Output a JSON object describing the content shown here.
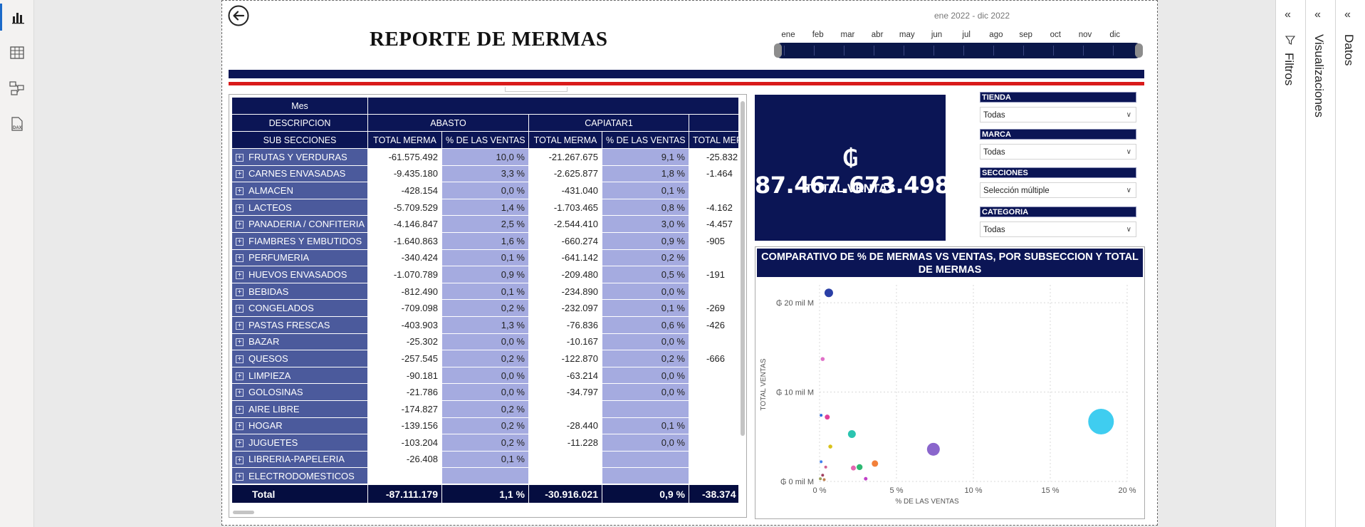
{
  "nav": {
    "icons": [
      "report-view-icon",
      "table-view-icon",
      "model-view-icon",
      "dax-query-icon"
    ]
  },
  "report": {
    "title": "REPORTE DE MERMAS",
    "date_range": "ene 2022 - dic 2022",
    "months": [
      "ene",
      "feb",
      "mar",
      "abr",
      "may",
      "jun",
      "jul",
      "ago",
      "sep",
      "oct",
      "nov",
      "dic"
    ]
  },
  "matrix": {
    "header_mes": "Mes",
    "header_descripcion": "DESCRIPCION",
    "header_subsecciones": "SUB SECCIONES",
    "groups": [
      "ABASTO",
      "CAPIATAR1"
    ],
    "col_total_merma": "TOTAL MERMA",
    "col_pct_ventas": "% DE LAS VENTAS",
    "col_total_merma_cut": "TOTAL MER",
    "rows": [
      {
        "label": "FRUTAS Y VERDURAS",
        "a_tm": "-61.575.492",
        "a_pct": "10,0 %",
        "c_tm": "-21.267.675",
        "c_pct": "9,1 %",
        "n_tm": "-25.832"
      },
      {
        "label": "CARNES ENVASADAS",
        "a_tm": "-9.435.180",
        "a_pct": "3,3 %",
        "c_tm": "-2.625.877",
        "c_pct": "1,8 %",
        "n_tm": "-1.464"
      },
      {
        "label": "ALMACEN",
        "a_tm": "-428.154",
        "a_pct": "0,0 %",
        "c_tm": "-431.040",
        "c_pct": "0,1 %",
        "n_tm": ""
      },
      {
        "label": "LACTEOS",
        "a_tm": "-5.709.529",
        "a_pct": "1,4 %",
        "c_tm": "-1.703.465",
        "c_pct": "0,8 %",
        "n_tm": "-4.162"
      },
      {
        "label": "PANADERIA / CONFITERIA",
        "a_tm": "-4.146.847",
        "a_pct": "2,5 %",
        "c_tm": "-2.544.410",
        "c_pct": "3,0 %",
        "n_tm": "-4.457"
      },
      {
        "label": "FIAMBRES Y EMBUTIDOS",
        "a_tm": "-1.640.863",
        "a_pct": "1,6 %",
        "c_tm": "-660.274",
        "c_pct": "0,9 %",
        "n_tm": "-905"
      },
      {
        "label": "PERFUMERIA",
        "a_tm": "-340.424",
        "a_pct": "0,1 %",
        "c_tm": "-641.142",
        "c_pct": "0,2 %",
        "n_tm": ""
      },
      {
        "label": "HUEVOS ENVASADOS",
        "a_tm": "-1.070.789",
        "a_pct": "0,9 %",
        "c_tm": "-209.480",
        "c_pct": "0,5 %",
        "n_tm": "-191"
      },
      {
        "label": "BEBIDAS",
        "a_tm": "-812.490",
        "a_pct": "0,1 %",
        "c_tm": "-234.890",
        "c_pct": "0,0 %",
        "n_tm": ""
      },
      {
        "label": "CONGELADOS",
        "a_tm": "-709.098",
        "a_pct": "0,2 %",
        "c_tm": "-232.097",
        "c_pct": "0,1 %",
        "n_tm": "-269"
      },
      {
        "label": "PASTAS FRESCAS",
        "a_tm": "-403.903",
        "a_pct": "1,3 %",
        "c_tm": "-76.836",
        "c_pct": "0,6 %",
        "n_tm": "-426"
      },
      {
        "label": "BAZAR",
        "a_tm": "-25.302",
        "a_pct": "0,0 %",
        "c_tm": "-10.167",
        "c_pct": "0,0 %",
        "n_tm": ""
      },
      {
        "label": "QUESOS",
        "a_tm": "-257.545",
        "a_pct": "0,2 %",
        "c_tm": "-122.870",
        "c_pct": "0,2 %",
        "n_tm": "-666"
      },
      {
        "label": "LIMPIEZA",
        "a_tm": "-90.181",
        "a_pct": "0,0 %",
        "c_tm": "-63.214",
        "c_pct": "0,0 %",
        "n_tm": ""
      },
      {
        "label": "GOLOSINAS",
        "a_tm": "-21.786",
        "a_pct": "0,0 %",
        "c_tm": "-34.797",
        "c_pct": "0,0 %",
        "n_tm": ""
      },
      {
        "label": "AIRE LIBRE",
        "a_tm": "-174.827",
        "a_pct": "0,2 %",
        "c_tm": "",
        "c_pct": "",
        "n_tm": ""
      },
      {
        "label": "HOGAR",
        "a_tm": "-139.156",
        "a_pct": "0,2 %",
        "c_tm": "-28.440",
        "c_pct": "0,1 %",
        "n_tm": ""
      },
      {
        "label": "JUGUETES",
        "a_tm": "-103.204",
        "a_pct": "0,2 %",
        "c_tm": "-11.228",
        "c_pct": "0,0 %",
        "n_tm": ""
      },
      {
        "label": "LIBRERIA-PAPELERIA",
        "a_tm": "-26.408",
        "a_pct": "0,1 %",
        "c_tm": "",
        "c_pct": "",
        "n_tm": ""
      },
      {
        "label": "ELECTRODOMESTICOS",
        "a_tm": "",
        "a_pct": "",
        "c_tm": "",
        "c_pct": "",
        "n_tm": ""
      }
    ],
    "total": {
      "label": "Total",
      "a_tm": "-87.111.179",
      "a_pct": "1,1 %",
      "c_tm": "-30.916.021",
      "c_pct": "0,9 %",
      "n_tm": "-38.374"
    }
  },
  "kpi": {
    "value": "₲ 87.467.673.498",
    "label": "TOTAL VENTAS"
  },
  "slicers": [
    {
      "title": "TIENDA",
      "value": "Todas"
    },
    {
      "title": "MARCA",
      "value": "Todas"
    },
    {
      "title": "SECCIONES",
      "value": "Selección múltiple"
    },
    {
      "title": "CATEGORIA",
      "value": "Todas"
    }
  ],
  "panes": {
    "filtros": "Filtros",
    "visualizaciones": "Visualizaciones",
    "datos": "Datos"
  },
  "chart_data": {
    "type": "scatter",
    "title": "COMPARATIVO DE % DE MERMAS VS VENTAS, POR SUBSECCION Y TOTAL DE MERMAS",
    "xlabel": "% DE LAS VENTAS",
    "ylabel": "TOTAL VENTAS",
    "xlim": [
      0,
      20
    ],
    "ylim": [
      0,
      22
    ],
    "x_ticks": [
      "0 %",
      "5 %",
      "10 %",
      "15 %",
      "20 %"
    ],
    "y_ticks": [
      "₲ 0 mil M",
      "₲ 10 mil M",
      "₲ 20 mil M"
    ],
    "grid": true,
    "points": [
      {
        "x": 18.3,
        "y": 6.7,
        "size": 18,
        "color": "#3fcdf0"
      },
      {
        "x": 7.4,
        "y": 3.6,
        "size": 9,
        "color": "#8a66cc"
      },
      {
        "x": 0.6,
        "y": 21.1,
        "size": 6,
        "color": "#2a3fa6"
      },
      {
        "x": 2.1,
        "y": 5.3,
        "size": 5.5,
        "color": "#2bc4b0"
      },
      {
        "x": 3.6,
        "y": 2.0,
        "size": 4.5,
        "color": "#f2803a"
      },
      {
        "x": 2.6,
        "y": 1.6,
        "size": 4.2,
        "color": "#2eb872"
      },
      {
        "x": 2.2,
        "y": 1.5,
        "size": 3.5,
        "color": "#e466b0"
      },
      {
        "x": 0.5,
        "y": 7.2,
        "size": 3.5,
        "color": "#e0409a"
      },
      {
        "x": 0.2,
        "y": 13.7,
        "size": 2.8,
        "color": "#e070c8"
      },
      {
        "x": 0.7,
        "y": 3.9,
        "size": 2.8,
        "color": "#d9c21a"
      },
      {
        "x": 3.0,
        "y": 0.3,
        "size": 2.5,
        "color": "#c040c8"
      },
      {
        "x": 0.1,
        "y": 7.4,
        "size": 2,
        "color": "#2f6ee0"
      },
      {
        "x": 0.1,
        "y": 2.2,
        "size": 2,
        "color": "#3f80ef"
      },
      {
        "x": 0.4,
        "y": 1.6,
        "size": 2,
        "color": "#d06090"
      },
      {
        "x": 0.2,
        "y": 0.7,
        "size": 2,
        "color": "#a04060"
      },
      {
        "x": 0.05,
        "y": 0.3,
        "size": 2,
        "color": "#9aa05a"
      },
      {
        "x": 0.3,
        "y": 0.2,
        "size": 2,
        "color": "#c08050"
      }
    ]
  }
}
